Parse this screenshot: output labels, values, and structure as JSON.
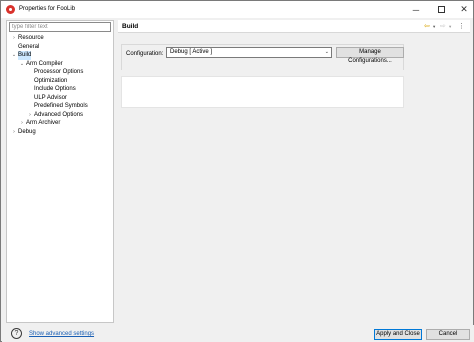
{
  "window": {
    "title": "Properties for FooLib",
    "minimize_glyph": "─",
    "close_glyph": "✕"
  },
  "filter": {
    "placeholder": "type filter text",
    "value": ""
  },
  "tree": {
    "items": [
      {
        "label": "Resource",
        "arrow": "›",
        "expanded": false,
        "selected": false
      },
      {
        "label": "General",
        "arrow": "",
        "expanded": false,
        "selected": false
      },
      {
        "label": "Build",
        "arrow": "⌄",
        "expanded": true,
        "selected": true
      },
      {
        "label": "Arm Compiler",
        "arrow": "⌄",
        "expanded": true,
        "selected": false
      },
      {
        "label": "Processor Options",
        "arrow": "",
        "expanded": false,
        "selected": false
      },
      {
        "label": "Optimization",
        "arrow": "",
        "expanded": false,
        "selected": false
      },
      {
        "label": "Include Options",
        "arrow": "",
        "expanded": false,
        "selected": false
      },
      {
        "label": "ULP Advisor",
        "arrow": "",
        "expanded": false,
        "selected": false
      },
      {
        "label": "Predefined Symbols",
        "arrow": "",
        "expanded": false,
        "selected": false
      },
      {
        "label": "Advanced Options",
        "arrow": "›",
        "expanded": false,
        "selected": false
      },
      {
        "label": "Arm Archiver",
        "arrow": "›",
        "expanded": false,
        "selected": false
      },
      {
        "label": "Debug",
        "arrow": "›",
        "expanded": false,
        "selected": false
      }
    ]
  },
  "page": {
    "title": "Build",
    "nav_back_glyph": "⇦",
    "nav_forward_glyph": "⇨",
    "dropdown_glyph": "▾",
    "menu_glyph": "⋮"
  },
  "configuration": {
    "label": "Configuration:",
    "selected": "Debug  [ Active ]",
    "chevron_glyph": "⌄",
    "manage_button": "Manage Configurations..."
  },
  "bottom": {
    "help_glyph": "?",
    "advanced_link": "Show advanced settings",
    "apply_close": "Apply and Close",
    "cancel": "Cancel"
  },
  "colors": {
    "selection": "#cce8ff",
    "link": "#1a5fb4",
    "default_button_border": "#0078d7",
    "app_icon": "#d9322c",
    "back_arrow": "#d8a300"
  }
}
